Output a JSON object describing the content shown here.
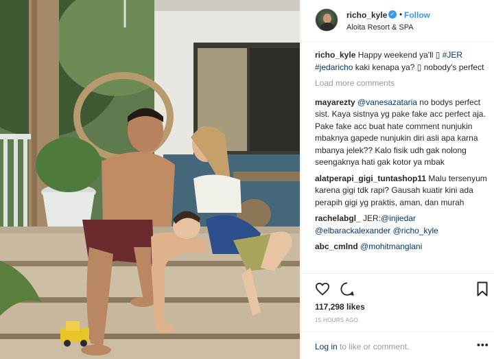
{
  "post": {
    "username": "richo_kyle",
    "verified_mark": "✓",
    "separator": "•",
    "follow_label": "Follow",
    "location": "Aloita Resort & SPA"
  },
  "caption": {
    "user": "richo_kyle",
    "text_a": " Happy weekend ya'll ",
    "emoji_a": "▯",
    "hashtag_1": "#JER",
    "hashtag_2": "#jedaricho",
    "text_b": " kaki kenapa ya? ",
    "emoji_b": "▯",
    "text_c": " nobody's perfect"
  },
  "load_more": "Load more comments",
  "comments": [
    {
      "user": "mayarezty",
      "mention": "@vanesazataria",
      "text": " no bodys perfect sist. Kaya sistnya yg pake fake acc perfect aja. Pake fake acc buat hate comment nunjukin mbaknya gapede nunjukin diri asli apa karna mbanya jelek?? Kalo fisik udh gak nolong seengaknya hati gak kotor ya mbak"
    },
    {
      "user": "alatperapi_gigi_tuntashop11",
      "text": " Malu tersenyum karena gigi tdk rapi? Gausah kuatir kini ada perapih gigi yg praktis, aman, dan murah"
    },
    {
      "user": "rachelabgl_",
      "prefix": " JER:",
      "mention_1": "@injiedar",
      "mention_2": "@elbarackalexander",
      "mention_3": "@richo_kyle"
    },
    {
      "user": "abc_cmlnd",
      "mention": "@mohitmanglani"
    }
  ],
  "likes": "117,298 likes",
  "timestamp": "15 HOURS AGO",
  "footer": {
    "login_link": "Log in",
    "login_rest": " to like or comment.",
    "more": "•••"
  },
  "icons": {
    "like": "heart-icon",
    "comment": "comment-icon",
    "save": "bookmark-icon",
    "verified": "verified-badge-icon"
  },
  "colors": {
    "link_blue": "#3897f0",
    "mention_navy": "#003569",
    "muted": "#999999",
    "text": "#262626"
  }
}
